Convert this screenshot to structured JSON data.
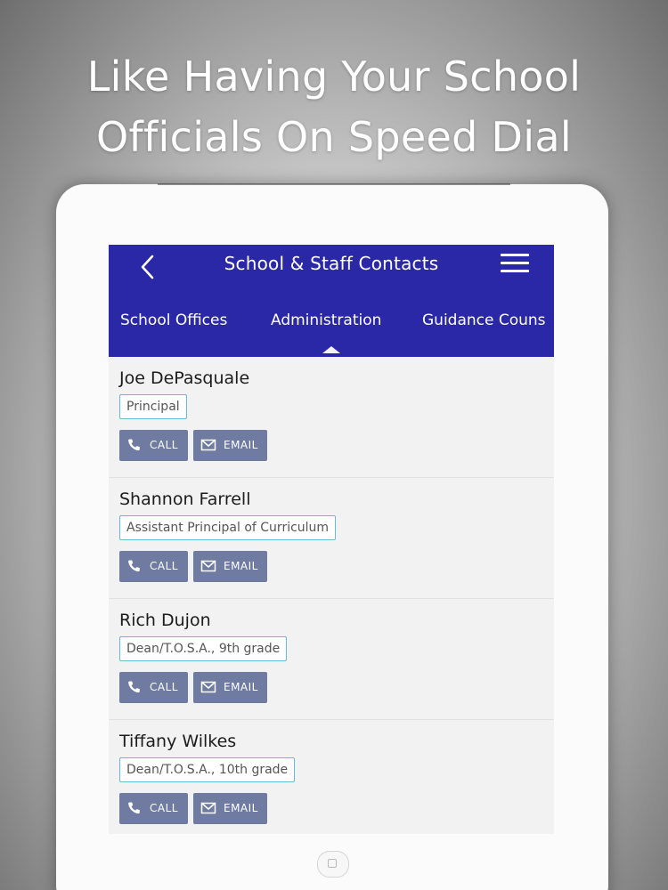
{
  "headline": {
    "line1": "Like Having Your School",
    "line2": "Officials On Speed Dial"
  },
  "app": {
    "title": "School & Staff Contacts",
    "back_icon": "chevron-left-icon",
    "menu_icon": "hamburger-menu-icon",
    "header_color": "#2a28a6"
  },
  "tabs": [
    {
      "label": "School Offices",
      "active": false
    },
    {
      "label": "Administration",
      "active": true
    },
    {
      "label": "Guidance Couns",
      "active": false
    }
  ],
  "contacts": [
    {
      "name": "Joe DePasquale",
      "role": "Principal",
      "call_label": "CALL",
      "email_label": "EMAIL"
    },
    {
      "name": "Shannon Farrell",
      "role": "Assistant Principal of Curriculum",
      "call_label": "CALL",
      "email_label": "EMAIL"
    },
    {
      "name": "Rich Dujon",
      "role": "Dean/T.O.S.A., 9th grade",
      "call_label": "CALL",
      "email_label": "EMAIL"
    },
    {
      "name": "Tiffany Wilkes",
      "role": "Dean/T.O.S.A., 10th grade",
      "call_label": "CALL",
      "email_label": "EMAIL"
    }
  ],
  "colors": {
    "button": "#6f7ba0",
    "role_border": "#6cb8d8"
  }
}
